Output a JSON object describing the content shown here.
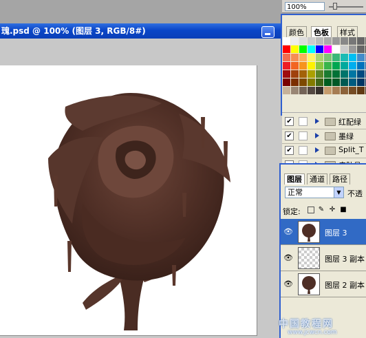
{
  "document": {
    "title": "瑰.psd @ 100% (图层 3, RGB/8#)"
  },
  "navigator": {
    "zoom": "100%"
  },
  "swatches_panel": {
    "tabs": [
      "颜色",
      "色板",
      "样式"
    ],
    "active_tab": "色板",
    "colors": [
      "#ffffff",
      "#eeeeee",
      "#dddddd",
      "#cccccc",
      "#bbbbbb",
      "#aaaaaa",
      "#999999",
      "#888888",
      "#777777",
      "#666666",
      "#555555",
      "#ff0000",
      "#ffff00",
      "#00ff00",
      "#00ffff",
      "#0000ff",
      "#ff00ff",
      "#ffffff",
      "#cccccc",
      "#999999",
      "#666666",
      "#333333",
      "#f26c4f",
      "#f68e55",
      "#fbaf5c",
      "#fff467",
      "#acd372",
      "#7cc576",
      "#3bb878",
      "#1abbb4",
      "#00bff3",
      "#438ccb",
      "#5574b9",
      "#ed1c24",
      "#f26522",
      "#f7941d",
      "#fff200",
      "#8dc63f",
      "#39b54a",
      "#00a651",
      "#00a99d",
      "#00aeef",
      "#0072bc",
      "#0054a6",
      "#9e0b0f",
      "#a0410d",
      "#a36209",
      "#aba000",
      "#598527",
      "#1a7b30",
      "#007236",
      "#00746b",
      "#0076a3",
      "#004a80",
      "#003471",
      "#790000",
      "#7b2e00",
      "#7d4900",
      "#827b00",
      "#406618",
      "#005e20",
      "#005826",
      "#005952",
      "#005b7f",
      "#003663",
      "#002157",
      "#c7b299",
      "#998675",
      "#736357",
      "#534741",
      "#37302d",
      "#c69c6d",
      "#a67c52",
      "#8c6239",
      "#754c24",
      "#603913",
      "#3c2415"
    ]
  },
  "layer_groups": [
    {
      "checked": true,
      "name": "红配绿"
    },
    {
      "checked": true,
      "name": "墨绿"
    },
    {
      "checked": true,
      "name": "Split_T"
    },
    {
      "checked": false,
      "name": "皮肤具"
    }
  ],
  "layers_panel": {
    "tabs": [
      "图层",
      "通道",
      "路径"
    ],
    "active_tab": "图层",
    "blend_mode": "正常",
    "opacity_label": "不透",
    "lock_label": "锁定:",
    "layers": [
      {
        "name": "图层 3",
        "selected": true
      },
      {
        "name": "图层 3 副本",
        "selected": false
      },
      {
        "name": "图层 2 副本",
        "selected": false
      }
    ]
  },
  "watermark": {
    "text": "中国教程网",
    "url": "www.jcwcn.com"
  }
}
